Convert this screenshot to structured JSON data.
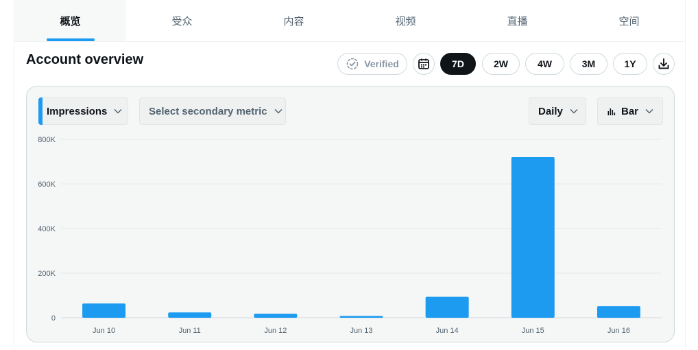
{
  "tabs": [
    {
      "label": "概览",
      "active": true
    },
    {
      "label": "受众",
      "active": false
    },
    {
      "label": "内容",
      "active": false
    },
    {
      "label": "视频",
      "active": false
    },
    {
      "label": "直播",
      "active": false
    },
    {
      "label": "空间",
      "active": false
    }
  ],
  "header": {
    "title": "Account overview",
    "verified_label": "Verified",
    "ranges": [
      "7D",
      "2W",
      "4W",
      "3M",
      "1Y"
    ],
    "selected_range": "7D"
  },
  "controls": {
    "primary_metric": "Impressions",
    "secondary_metric_placeholder": "Select secondary metric",
    "granularity": "Daily",
    "chart_type_label": "Bar"
  },
  "colors": {
    "accent": "#1d9bf0",
    "dark_button": "#0f1419",
    "card_bg": "#f5f6f6"
  },
  "chart_data": {
    "type": "bar",
    "categories": [
      "Jun 10",
      "Jun 11",
      "Jun 12",
      "Jun 13",
      "Jun 14",
      "Jun 15",
      "Jun 16"
    ],
    "values": [
      64000,
      24000,
      18000,
      8000,
      94000,
      720000,
      52000
    ],
    "ylim": [
      0,
      800000
    ],
    "yticks": [
      "0",
      "200K",
      "400K",
      "600K",
      "800K"
    ],
    "ytick_values": [
      0,
      200000,
      400000,
      600000,
      800000
    ],
    "grid": true,
    "title": "",
    "xlabel": "",
    "ylabel": ""
  }
}
